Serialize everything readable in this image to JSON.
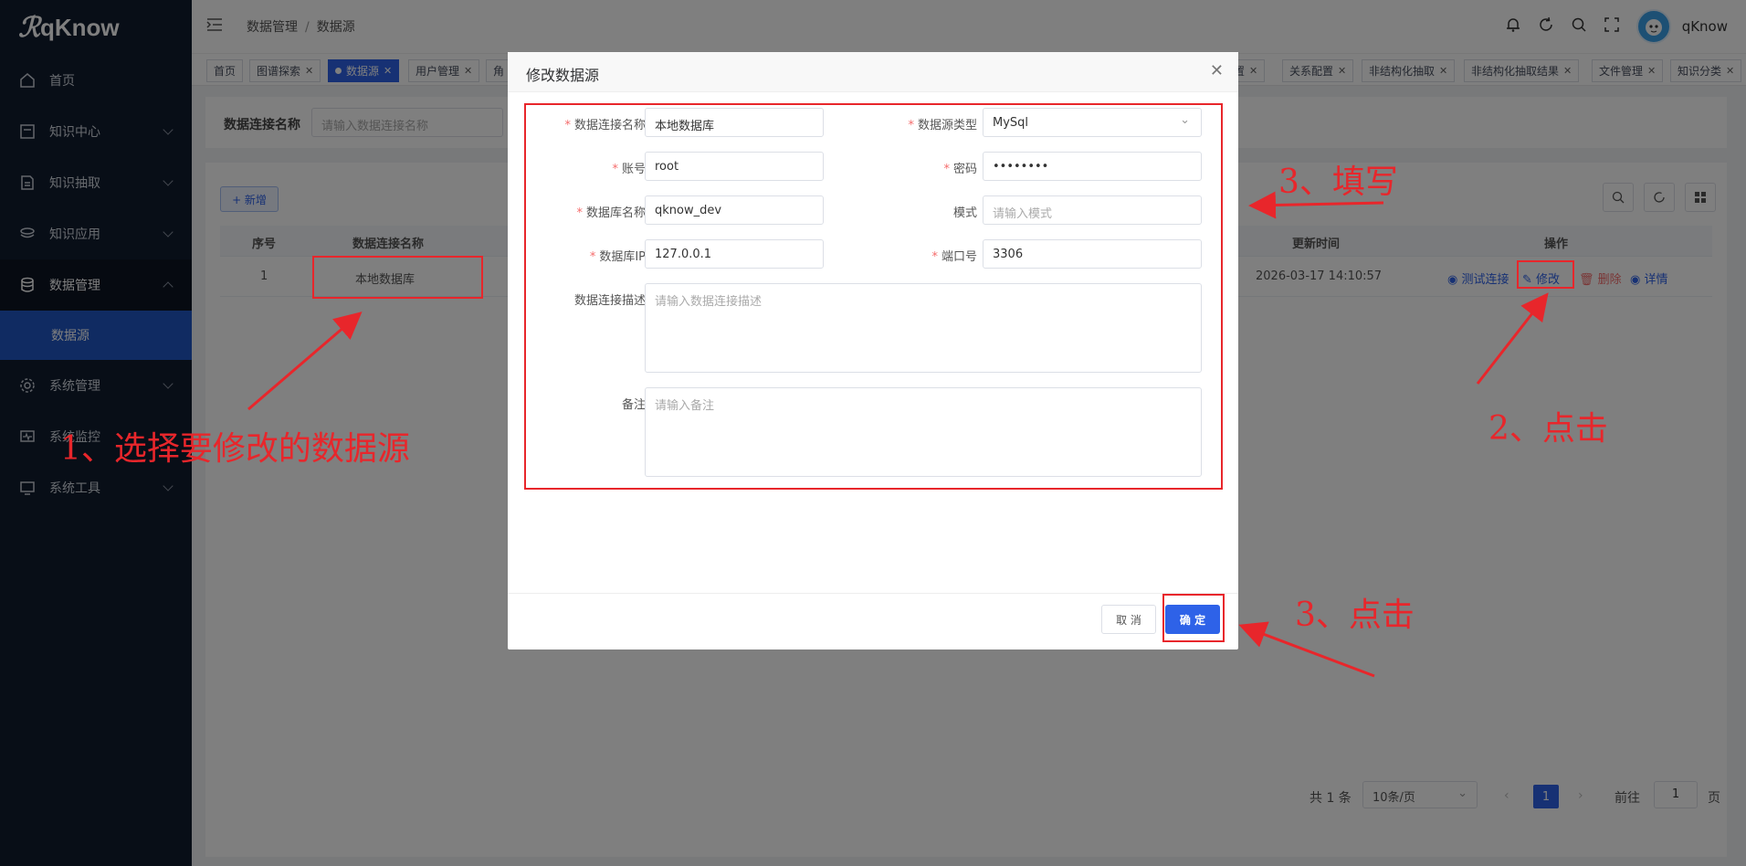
{
  "app": {
    "name": "qKnow"
  },
  "sidebar": {
    "items": [
      {
        "label": "首页",
        "icon": "home-icon"
      },
      {
        "label": "知识中心",
        "icon": "book-icon"
      },
      {
        "label": "知识抽取",
        "icon": "document-icon"
      },
      {
        "label": "知识应用",
        "icon": "stack-icon"
      },
      {
        "label": "数据管理",
        "icon": "database-icon"
      },
      {
        "label": "系统管理",
        "icon": "gear-icon"
      },
      {
        "label": "系统监控",
        "icon": "monitor-icon"
      },
      {
        "label": "系统工具",
        "icon": "tool-icon"
      }
    ],
    "active_sub": "数据源"
  },
  "header": {
    "breadcrumb": [
      "数据管理",
      "数据源"
    ],
    "username": "qKnow"
  },
  "tabs": [
    "首页",
    "图谱探索",
    "数据源",
    "用户管理",
    "角",
    "配置",
    "关系配置",
    "非结构化抽取",
    "非结构化抽取结果",
    "文件管理",
    "知识分类"
  ],
  "search": {
    "label": "数据连接名称",
    "placeholder": "请输入数据连接名称"
  },
  "toolbar": {
    "add_label": "+ 新增"
  },
  "table": {
    "headers": {
      "index": "序号",
      "name": "数据连接名称",
      "updated": "更新时间",
      "ops": "操作"
    },
    "rows": [
      {
        "index": "1",
        "name": "本地数据库",
        "updated": "2026-03-17 14:10:57"
      }
    ],
    "ops": {
      "test": "测试连接",
      "edit": "修改",
      "delete": "删除",
      "detail": "详情"
    }
  },
  "pagination": {
    "total": "共 1 条",
    "page_size": "10条/页",
    "current": "1",
    "goto": "前往",
    "page_input": "1",
    "page_unit": "页"
  },
  "dialog": {
    "title": "修改数据源",
    "fields": {
      "name": {
        "label": "数据连接名称",
        "value": "本地数据库"
      },
      "type": {
        "label": "数据源类型",
        "value": "MySql"
      },
      "account": {
        "label": "账号",
        "value": "root"
      },
      "password": {
        "label": "密码",
        "value": "••••••••"
      },
      "dbname": {
        "label": "数据库名称",
        "value": "qknow_dev"
      },
      "schema": {
        "label": "模式",
        "placeholder": "请输入模式"
      },
      "ip": {
        "label": "数据库IP",
        "value": "127.0.0.1"
      },
      "port": {
        "label": "端口号",
        "value": "3306"
      },
      "desc": {
        "label": "数据连接描述",
        "placeholder": "请输入数据连接描述"
      },
      "remark": {
        "label": "备注",
        "placeholder": "请输入备注"
      }
    },
    "cancel_label": "取 消",
    "ok_label": "确 定"
  },
  "annotations": {
    "step1": "1、选择要修改的数据源",
    "step2": "2、点击",
    "step3a": "3、填写",
    "step3b": "3、点击"
  },
  "colors": {
    "sidebar_bg": "#111c2e",
    "primary": "#2e62e8",
    "annotation": "#e8262b"
  }
}
